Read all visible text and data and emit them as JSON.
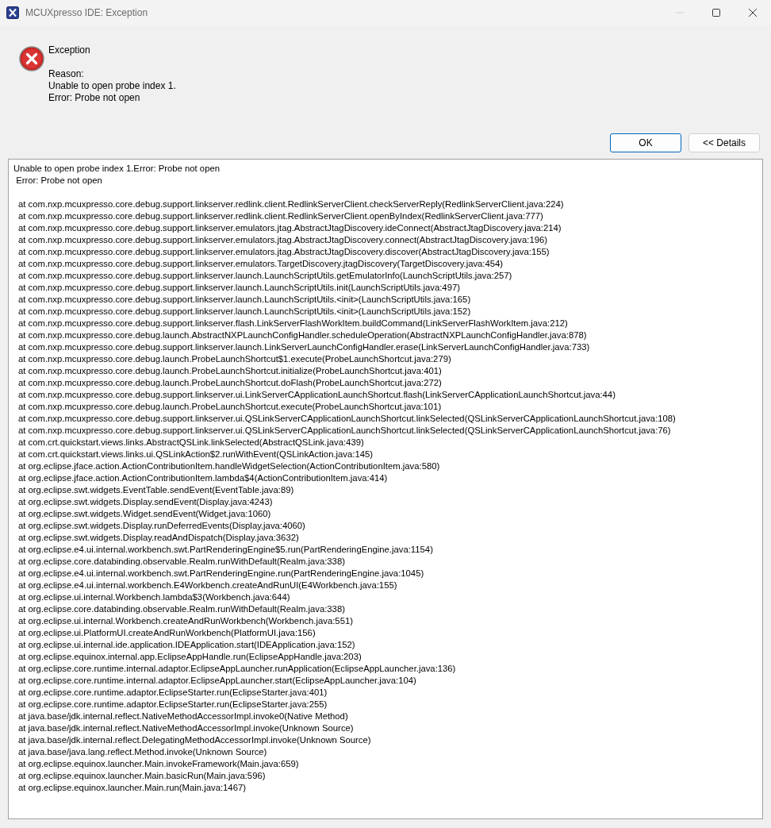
{
  "window": {
    "title": "MCUXpresso IDE: Exception",
    "minimize_disabled": true
  },
  "header": {
    "title": "Exception",
    "reason_label": "Reason:",
    "reason_lines": [
      "Unable to open probe index 1.",
      "Error: Probe not open"
    ]
  },
  "buttons": [
    {
      "label": "OK",
      "default": true
    },
    {
      "label": "<< Details",
      "default": false
    }
  ],
  "details": {
    "message_lines": [
      "Unable to open probe index 1.Error: Probe not open",
      " Error: Probe not open"
    ],
    "frames": [
      "at com.nxp.mcuxpresso.core.debug.support.linkserver.redlink.client.RedlinkServerClient.checkServerReply(RedlinkServerClient.java:224)",
      "at com.nxp.mcuxpresso.core.debug.support.linkserver.redlink.client.RedlinkServerClient.openByIndex(RedlinkServerClient.java:777)",
      "at com.nxp.mcuxpresso.core.debug.support.linkserver.emulators.jtag.AbstractJtagDiscovery.ideConnect(AbstractJtagDiscovery.java:214)",
      "at com.nxp.mcuxpresso.core.debug.support.linkserver.emulators.jtag.AbstractJtagDiscovery.connect(AbstractJtagDiscovery.java:196)",
      "at com.nxp.mcuxpresso.core.debug.support.linkserver.emulators.jtag.AbstractJtagDiscovery.discover(AbstractJtagDiscovery.java:155)",
      "at com.nxp.mcuxpresso.core.debug.support.linkserver.emulators.TargetDiscovery.jtagDiscovery(TargetDiscovery.java:454)",
      "at com.nxp.mcuxpresso.core.debug.support.linkserver.launch.LaunchScriptUtils.getEmulatorInfo(LaunchScriptUtils.java:257)",
      "at com.nxp.mcuxpresso.core.debug.support.linkserver.launch.LaunchScriptUtils.init(LaunchScriptUtils.java:497)",
      "at com.nxp.mcuxpresso.core.debug.support.linkserver.launch.LaunchScriptUtils.<init>(LaunchScriptUtils.java:165)",
      "at com.nxp.mcuxpresso.core.debug.support.linkserver.launch.LaunchScriptUtils.<init>(LaunchScriptUtils.java:152)",
      "at com.nxp.mcuxpresso.core.debug.support.linkserver.flash.LinkServerFlashWorkItem.buildCommand(LinkServerFlashWorkItem.java:212)",
      "at com.nxp.mcuxpresso.core.debug.launch.AbstractNXPLaunchConfigHandler.scheduleOperation(AbstractNXPLaunchConfigHandler.java:878)",
      "at com.nxp.mcuxpresso.core.debug.support.linkserver.launch.LinkServerLaunchConfigHandler.erase(LinkServerLaunchConfigHandler.java:733)",
      "at com.nxp.mcuxpresso.core.debug.launch.ProbeLaunchShortcut$1.execute(ProbeLaunchShortcut.java:279)",
      "at com.nxp.mcuxpresso.core.debug.launch.ProbeLaunchShortcut.initialize(ProbeLaunchShortcut.java:401)",
      "at com.nxp.mcuxpresso.core.debug.launch.ProbeLaunchShortcut.doFlash(ProbeLaunchShortcut.java:272)",
      "at com.nxp.mcuxpresso.core.debug.support.linkserver.ui.LinkServerCApplicationLaunchShortcut.flash(LinkServerCApplicationLaunchShortcut.java:44)",
      "at com.nxp.mcuxpresso.core.debug.launch.ProbeLaunchShortcut.execute(ProbeLaunchShortcut.java:101)",
      "at com.nxp.mcuxpresso.core.debug.support.linkserver.ui.QSLinkServerCApplicationLaunchShortcut.linkSelected(QSLinkServerCApplicationLaunchShortcut.java:108)",
      "at com.nxp.mcuxpresso.core.debug.support.linkserver.ui.QSLinkServerCApplicationLaunchShortcut.linkSelected(QSLinkServerCApplicationLaunchShortcut.java:76)",
      "at com.crt.quickstart.views.links.AbstractQSLink.linkSelected(AbstractQSLink.java:439)",
      "at com.crt.quickstart.views.links.ui.QSLinkAction$2.runWithEvent(QSLinkAction.java:145)",
      "at org.eclipse.jface.action.ActionContributionItem.handleWidgetSelection(ActionContributionItem.java:580)",
      "at org.eclipse.jface.action.ActionContributionItem.lambda$4(ActionContributionItem.java:414)",
      "at org.eclipse.swt.widgets.EventTable.sendEvent(EventTable.java:89)",
      "at org.eclipse.swt.widgets.Display.sendEvent(Display.java:4243)",
      "at org.eclipse.swt.widgets.Widget.sendEvent(Widget.java:1060)",
      "at org.eclipse.swt.widgets.Display.runDeferredEvents(Display.java:4060)",
      "at org.eclipse.swt.widgets.Display.readAndDispatch(Display.java:3632)",
      "at org.eclipse.e4.ui.internal.workbench.swt.PartRenderingEngine$5.run(PartRenderingEngine.java:1154)",
      "at org.eclipse.core.databinding.observable.Realm.runWithDefault(Realm.java:338)",
      "at org.eclipse.e4.ui.internal.workbench.swt.PartRenderingEngine.run(PartRenderingEngine.java:1045)",
      "at org.eclipse.e4.ui.internal.workbench.E4Workbench.createAndRunUI(E4Workbench.java:155)",
      "at org.eclipse.ui.internal.Workbench.lambda$3(Workbench.java:644)",
      "at org.eclipse.core.databinding.observable.Realm.runWithDefault(Realm.java:338)",
      "at org.eclipse.ui.internal.Workbench.createAndRunWorkbench(Workbench.java:551)",
      "at org.eclipse.ui.PlatformUI.createAndRunWorkbench(PlatformUI.java:156)",
      "at org.eclipse.ui.internal.ide.application.IDEApplication.start(IDEApplication.java:152)",
      "at org.eclipse.equinox.internal.app.EclipseAppHandle.run(EclipseAppHandle.java:203)",
      "at org.eclipse.core.runtime.internal.adaptor.EclipseAppLauncher.runApplication(EclipseAppLauncher.java:136)",
      "at org.eclipse.core.runtime.internal.adaptor.EclipseAppLauncher.start(EclipseAppLauncher.java:104)",
      "at org.eclipse.core.runtime.adaptor.EclipseStarter.run(EclipseStarter.java:401)",
      "at org.eclipse.core.runtime.adaptor.EclipseStarter.run(EclipseStarter.java:255)",
      "at java.base/jdk.internal.reflect.NativeMethodAccessorImpl.invoke0(Native Method)",
      "at java.base/jdk.internal.reflect.NativeMethodAccessorImpl.invoke(Unknown Source)",
      "at java.base/jdk.internal.reflect.DelegatingMethodAccessorImpl.invoke(Unknown Source)",
      "at java.base/java.lang.reflect.Method.invoke(Unknown Source)",
      "at org.eclipse.equinox.launcher.Main.invokeFramework(Main.java:659)",
      "at org.eclipse.equinox.launcher.Main.basicRun(Main.java:596)",
      "at org.eclipse.equinox.launcher.Main.run(Main.java:1467)"
    ]
  }
}
